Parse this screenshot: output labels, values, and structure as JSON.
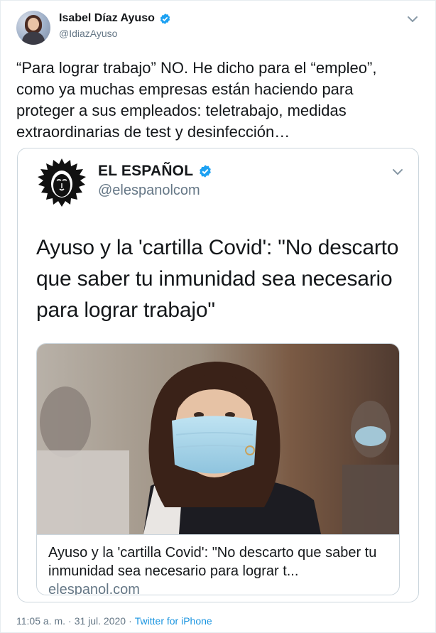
{
  "author": {
    "display_name": "Isabel Díaz Ayuso",
    "handle": "@IdiazAyuso"
  },
  "tweet": {
    "text": "“Para lograr trabajo” NO. He dicho para el “empleo”,\ncomo ya muchas empresas están haciendo para\nproteger a sus empleados: teletrabajo, medidas\nextraordinarias de test y desinfección…"
  },
  "quoted_tweet": {
    "display_name": "EL ESPAÑOL",
    "handle": "@elespanolcom",
    "text": "Ayuso y la 'cartilla Covid': \"No descarto que saber tu inmunidad sea necesario para lograr trabajo\"",
    "card": {
      "title": "Ayuso y la 'cartilla Covid': \"No descarto que saber tu inmunidad sea necesario para lograr t...",
      "domain": "elespanol.com"
    }
  },
  "meta": {
    "time": "11:05 a. m.",
    "separator": "·",
    "date": "31 jul. 2020",
    "separator2": "·",
    "source": "Twitter for iPhone"
  },
  "colors": {
    "accent": "#1da1f2",
    "muted_text": "#657786",
    "border": "#ccd6dd"
  },
  "icons": {
    "verified": "verified-badge-icon",
    "caret": "chevron-down-icon",
    "logo": "lion-logo-icon"
  }
}
